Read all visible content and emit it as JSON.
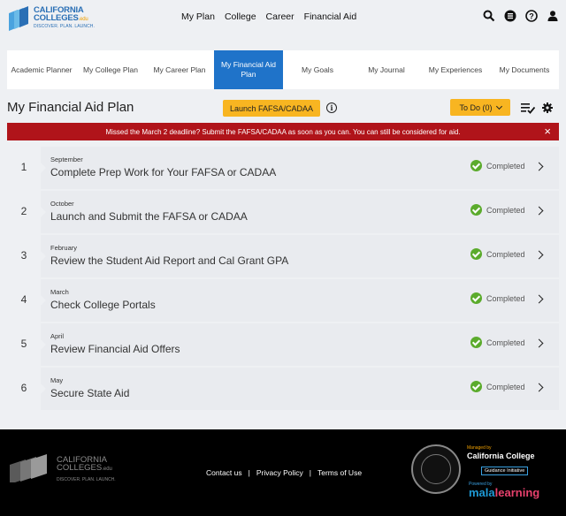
{
  "header": {
    "logo": {
      "name": "CALIFORNIA",
      "name2": "COLLEGES",
      "edu": ".edu",
      "tagline": "DISCOVER. PLAN. LAUNCH."
    },
    "menu": [
      "My Plan",
      "College",
      "Career",
      "Financial Aid"
    ],
    "icons": [
      "search-icon",
      "list-icon",
      "help-icon",
      "user-icon"
    ]
  },
  "tabs": [
    {
      "label": "Academic Planner",
      "active": false
    },
    {
      "label": "My College Plan",
      "active": false
    },
    {
      "label": "My Career Plan",
      "active": false
    },
    {
      "label": "My Financial Aid Plan",
      "active": true
    },
    {
      "label": "My Goals",
      "active": false
    },
    {
      "label": "My Journal",
      "active": false
    },
    {
      "label": "My Experiences",
      "active": false
    },
    {
      "label": "My Documents",
      "active": false
    }
  ],
  "page": {
    "title": "My Financial Aid Plan",
    "launch_button": "Launch FAFSA/CADAA",
    "todo_button": "To Do (0)"
  },
  "alert": {
    "message": "Missed the March 2 deadline? Submit the FAFSA/CADAA as soon as you can. You can still be considered for aid.",
    "close": "×",
    "color": "#b0141a"
  },
  "steps": [
    {
      "num": "1",
      "month": "September",
      "title": "Complete Prep Work for Your FAFSA or CADAA",
      "status": "Completed"
    },
    {
      "num": "2",
      "month": "October",
      "title": "Launch and Submit the FAFSA or CADAA",
      "status": "Completed"
    },
    {
      "num": "3",
      "month": "February",
      "title": "Review the Student Aid Report and Cal Grant GPA",
      "status": "Completed"
    },
    {
      "num": "4",
      "month": "March",
      "title": "Check College Portals",
      "status": "Completed"
    },
    {
      "num": "5",
      "month": "April",
      "title": "Review Financial Aid Offers",
      "status": "Completed"
    },
    {
      "num": "6",
      "month": "May",
      "title": "Secure State Aid",
      "status": "Completed"
    }
  ],
  "footer": {
    "logo": {
      "name": "CALIFORNIA",
      "name2": "COLLEGES",
      "edu": ".edu",
      "tagline": "DISCOVER. PLAN. LAUNCH."
    },
    "links": [
      "Contact us",
      "Privacy Policy",
      "Terms of Use"
    ],
    "managed_by": "Managed by",
    "ccgi": "California College",
    "ccgi_sub": "Guidance Initiative",
    "powered_by": "Powered by",
    "mala": "mala",
    "learning": "learning"
  },
  "colors": {
    "accent": "#1f73c9",
    "button": "#f8b521",
    "success": "#5bab2c"
  }
}
